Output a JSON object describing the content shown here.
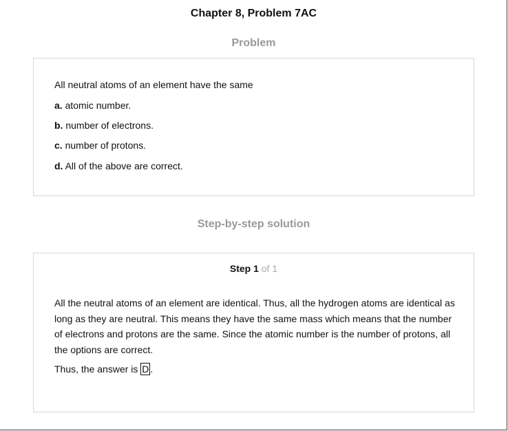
{
  "header": {
    "chapter_title": "Chapter 8, Problem 7AC"
  },
  "problem": {
    "heading": "Problem",
    "question": "All neutral atoms of an element have the same",
    "options": [
      {
        "letter": "a.",
        "text": "atomic number."
      },
      {
        "letter": "b.",
        "text": "number of electrons."
      },
      {
        "letter": "c.",
        "text": "number of protons."
      },
      {
        "letter": "d.",
        "text": "All of the above are correct."
      }
    ]
  },
  "solution": {
    "heading": "Step-by-step solution",
    "step_label": "Step 1",
    "step_of": "of 1",
    "explanation": "All the neutral atoms of an element are identical. Thus, all the hydrogen atoms are identical as long as they are neutral. This means they have the same mass which means that the number of electrons and protons are the same. Since the atomic number is the number of protons, all the options are correct.",
    "answer_prefix": "Thus, the answer is ",
    "answer_value": "D",
    "answer_suffix": "."
  }
}
